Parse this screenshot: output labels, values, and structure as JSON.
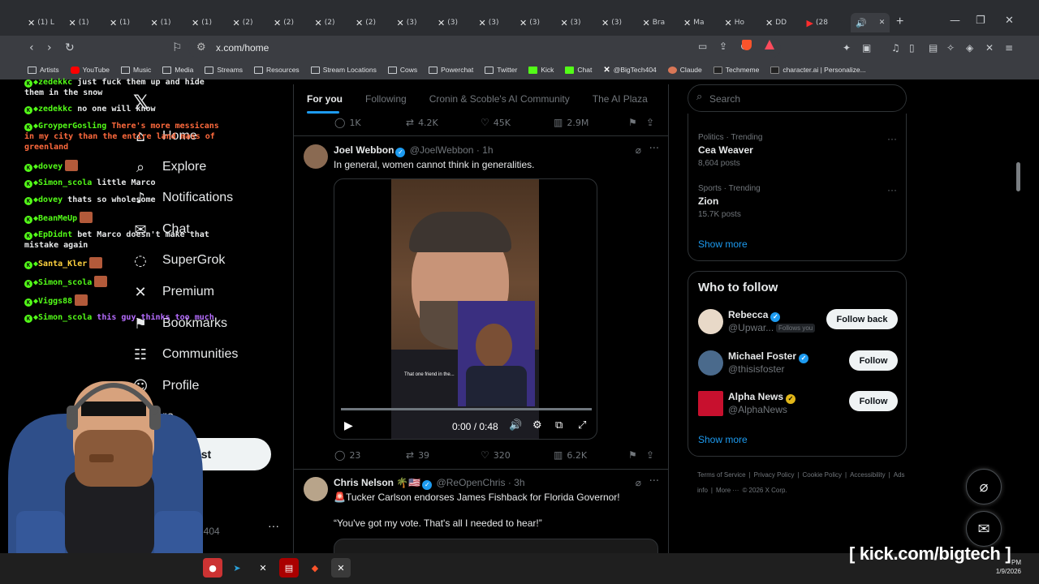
{
  "browser": {
    "tabs": [
      {
        "icon": "X",
        "label": "(1) L"
      },
      {
        "icon": "X",
        "label": "(1) "
      },
      {
        "icon": "X",
        "label": "(1) "
      },
      {
        "icon": "X",
        "label": "(1) "
      },
      {
        "icon": "X",
        "label": "(1) "
      },
      {
        "icon": "X",
        "label": "(2) "
      },
      {
        "icon": "X",
        "label": "(2) "
      },
      {
        "icon": "X",
        "label": "(2) "
      },
      {
        "icon": "X",
        "label": "(2) "
      },
      {
        "icon": "X",
        "label": "(3) "
      },
      {
        "icon": "X",
        "label": "(3) "
      },
      {
        "icon": "X",
        "label": "(3) "
      },
      {
        "icon": "X",
        "label": "(3) "
      },
      {
        "icon": "X",
        "label": "(3) "
      },
      {
        "icon": "X",
        "label": "(3) "
      },
      {
        "icon": "X",
        "label": "Bra"
      },
      {
        "icon": "X",
        "label": "Ma"
      },
      {
        "icon": "X",
        "label": "Ho"
      },
      {
        "icon": "X",
        "label": "DD"
      },
      {
        "icon": "YT",
        "label": "(28"
      }
    ],
    "url": "x.com/home",
    "bookmarks": [
      {
        "icon": "folder",
        "label": "Artists"
      },
      {
        "icon": "youtube",
        "label": "YouTube"
      },
      {
        "icon": "folder",
        "label": "Music"
      },
      {
        "icon": "folder",
        "label": "Media"
      },
      {
        "icon": "folder",
        "label": "Streams"
      },
      {
        "icon": "folder",
        "label": "Resources"
      },
      {
        "icon": "folder",
        "label": "Stream Locations"
      },
      {
        "icon": "folder",
        "label": "Cows"
      },
      {
        "icon": "folder",
        "label": "Powerchat"
      },
      {
        "icon": "folder",
        "label": "Twitter"
      },
      {
        "icon": "kick",
        "label": "Kick"
      },
      {
        "icon": "kick",
        "label": "Chat"
      },
      {
        "icon": "x",
        "label": "@BigTech404"
      },
      {
        "icon": "claude",
        "label": "Claude"
      },
      {
        "icon": "techmeme",
        "label": "Techmeme"
      },
      {
        "icon": "cai",
        "label": "character.ai | Personalize..."
      }
    ]
  },
  "nav": {
    "items": [
      {
        "icon": "home-icon",
        "glyph": "⌂",
        "label": "Home"
      },
      {
        "icon": "search-icon",
        "glyph": "⌕",
        "label": "Explore"
      },
      {
        "icon": "bell-icon",
        "glyph": "♪",
        "label": "Notifications"
      },
      {
        "icon": "chat-icon",
        "glyph": "✉",
        "label": "Chat"
      },
      {
        "icon": "grok-icon",
        "glyph": "◌",
        "label": "SuperGrok"
      },
      {
        "icon": "x-premium-icon",
        "glyph": "✕",
        "label": "Premium"
      },
      {
        "icon": "bookmark-icon",
        "glyph": "⚑",
        "label": "Bookmarks"
      },
      {
        "icon": "communities-icon",
        "glyph": "☷",
        "label": "Communities"
      },
      {
        "icon": "profile-icon",
        "glyph": "☺",
        "label": "Profile"
      },
      {
        "icon": "more-icon",
        "glyph": "⋯",
        "label": "re"
      }
    ],
    "post_label": "Post",
    "account_handle": "n404"
  },
  "chat": [
    {
      "user": "zedekkc",
      "text": "just fuck them up and hide them in the snow"
    },
    {
      "user": "zedekkc",
      "text": "no one will know"
    },
    {
      "user": "GroyperGosling",
      "text": "There's more messicans in my city than the entire land mass of greenland",
      "color": "#ff6a3d"
    },
    {
      "user": "dovey",
      "text": "",
      "emote": true
    },
    {
      "user": "Simon_scola",
      "text": "little Marco"
    },
    {
      "user": "dovey",
      "text": "thats so wholesome"
    },
    {
      "user": "BeanMeUp",
      "text": "",
      "emote": true
    },
    {
      "user": "EpDidnt",
      "text": "bet Marco doesn't make that mistake again"
    },
    {
      "user": "Santa_Kler",
      "text": "",
      "emote": true,
      "usercolor": "#ffd23f"
    },
    {
      "user": "Simon_scola",
      "text": "",
      "emote": true
    },
    {
      "user": "Viggs88",
      "text": "",
      "emote": true
    },
    {
      "user": "Simon_scola",
      "text": "this guy thinks too much",
      "color": "#b66dff"
    }
  ],
  "feed": {
    "tabs": [
      "For you",
      "Following",
      "Cronin & Scoble's AI Community",
      "The AI Plaza"
    ],
    "prev_actions": {
      "replies": "1K",
      "reposts": "4.2K",
      "likes": "45K",
      "views": "2.9M"
    },
    "posts": [
      {
        "name": "Joel Webbon",
        "handle": "@JoelWebbon",
        "time": "· 1h",
        "text": "In general, women cannot think in generalities.",
        "video": {
          "time": "0:00 / 0:48",
          "caption": "That one friend in the..."
        },
        "actions": {
          "replies": "23",
          "reposts": "39",
          "likes": "320",
          "views": "6.2K"
        }
      },
      {
        "name": "Chris Nelson 🌴🇺🇸",
        "handle": "@ReOpenChris",
        "time": "· 3h",
        "text": "🚨Tucker Carlson endorses James Fishback for Florida Governor!",
        "quote": "“You've got my vote. That's all I needed to hear!”"
      }
    ]
  },
  "sidebar": {
    "search_placeholder": "Search",
    "trends": [
      {
        "context": "Politics · Trending",
        "name": "Cea Weaver",
        "posts": "8,604 posts"
      },
      {
        "context": "Sports · Trending",
        "name": "Zion",
        "posts": "15.7K posts"
      }
    ],
    "show_more": "Show more",
    "who_to_follow": {
      "title": "Who to follow",
      "accounts": [
        {
          "name": "Rebecca",
          "handle": "@Upwar...",
          "follows_you": "Follows you",
          "button": "Follow back",
          "verified": "blue",
          "avatar_color": "#e8d9c8"
        },
        {
          "name": "Michael Foster",
          "handle": "@thisisfoster",
          "button": "Follow",
          "verified": "blue",
          "avatar_color": "#4a6a8c"
        },
        {
          "name": "Alpha News",
          "handle": "@AlphaNews",
          "button": "Follow",
          "verified": "gold",
          "avatar_color": "#c8102e"
        }
      ],
      "show_more": "Show more"
    },
    "footer": [
      "Terms of Service",
      "|",
      "Privacy Policy",
      "|",
      "Cookie Policy",
      "|",
      "Accessibility",
      "|",
      "Ads info",
      "|",
      "More ···",
      "© 2026 X Corp."
    ]
  },
  "watermark": "[ kick.com/bigtech ]",
  "clock": {
    "time": "PM",
    "date": "1/9/2026"
  },
  "colors": {
    "accent": "#1d9bf0",
    "kick_green": "#53fc18",
    "background": "#000000",
    "border": "#2f3336"
  }
}
